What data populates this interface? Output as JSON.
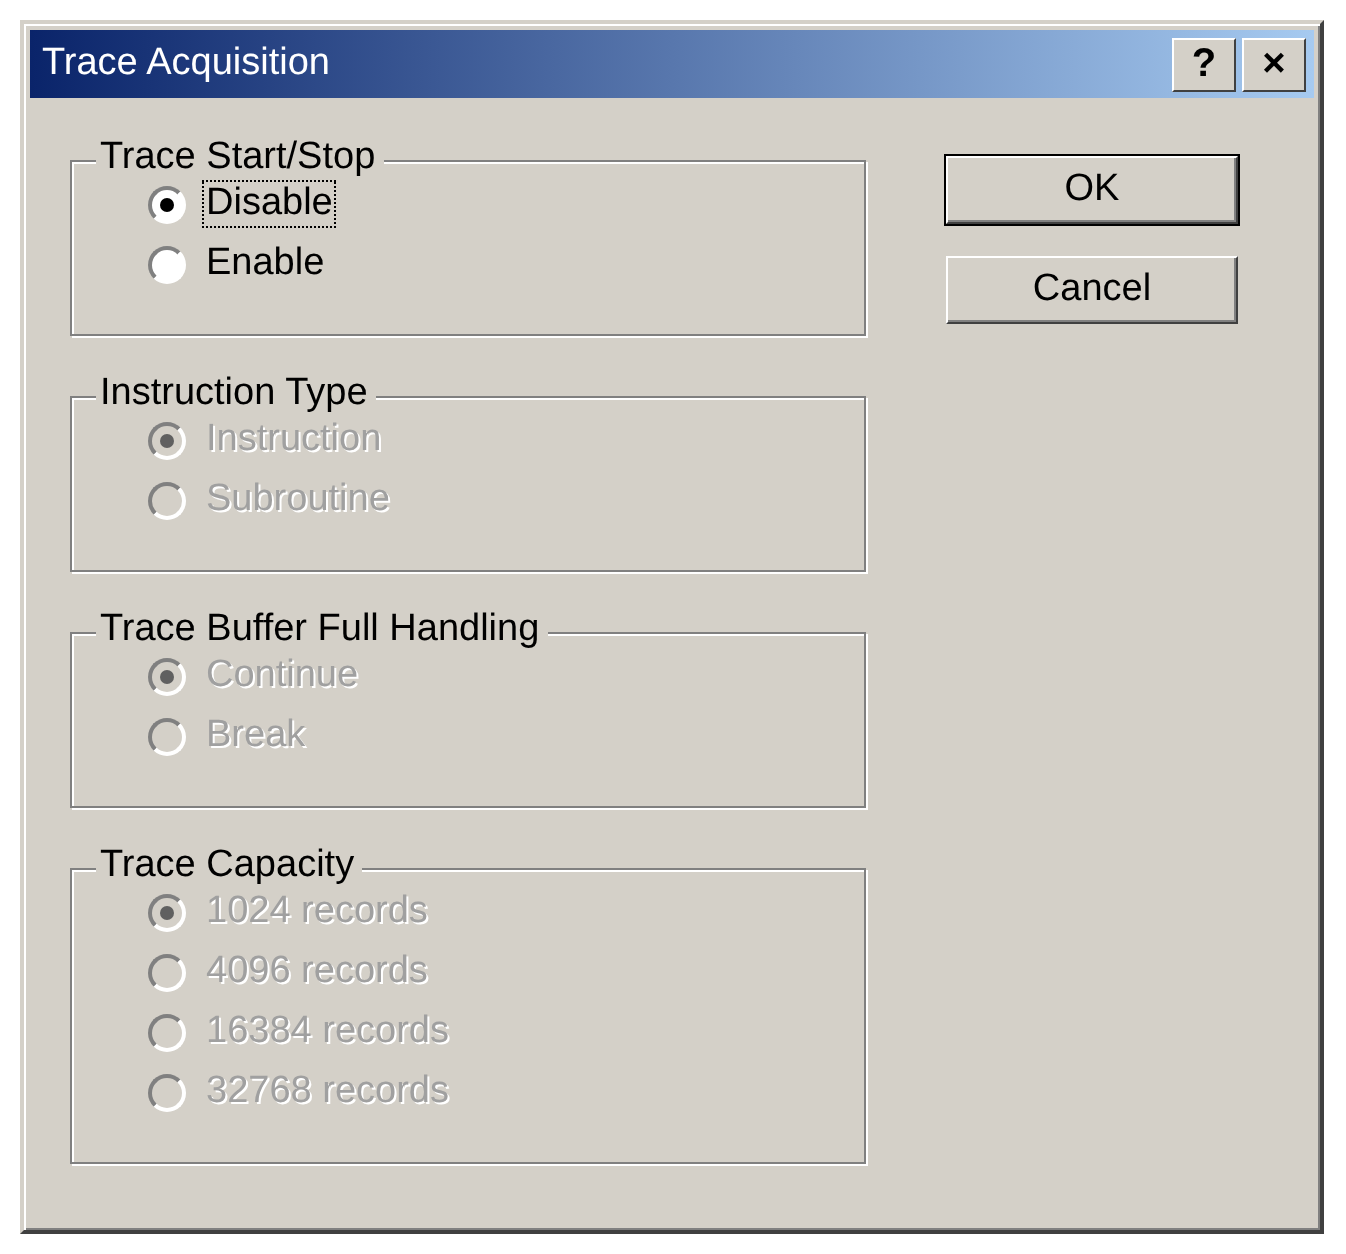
{
  "window": {
    "title": "Trace Acquisition",
    "title_buttons": [
      "?",
      "×"
    ]
  },
  "groups": [
    {
      "label": "Trace Start/Stop",
      "disabled": false,
      "options": [
        {
          "label": "Disable",
          "selected": true,
          "focused": true
        },
        {
          "label": "Enable",
          "selected": false,
          "focused": false
        }
      ]
    },
    {
      "label": "Instruction Type",
      "disabled": true,
      "options": [
        {
          "label": "Instruction",
          "selected": true,
          "focused": false
        },
        {
          "label": "Subroutine",
          "selected": false,
          "focused": false
        }
      ]
    },
    {
      "label": "Trace Buffer Full Handling",
      "disabled": true,
      "options": [
        {
          "label": "Continue",
          "selected": true,
          "focused": false
        },
        {
          "label": "Break",
          "selected": false,
          "focused": false
        }
      ]
    },
    {
      "label": "Trace Capacity",
      "disabled": true,
      "options": [
        {
          "label": "1024 records",
          "selected": true,
          "focused": false
        },
        {
          "label": "4096 records",
          "selected": false,
          "focused": false
        },
        {
          "label": "16384 records",
          "selected": false,
          "focused": false
        },
        {
          "label": "32768 records",
          "selected": false,
          "focused": false
        }
      ]
    }
  ],
  "buttons": [
    {
      "label": "OK",
      "default": true
    },
    {
      "label": "Cancel",
      "default": false
    }
  ]
}
